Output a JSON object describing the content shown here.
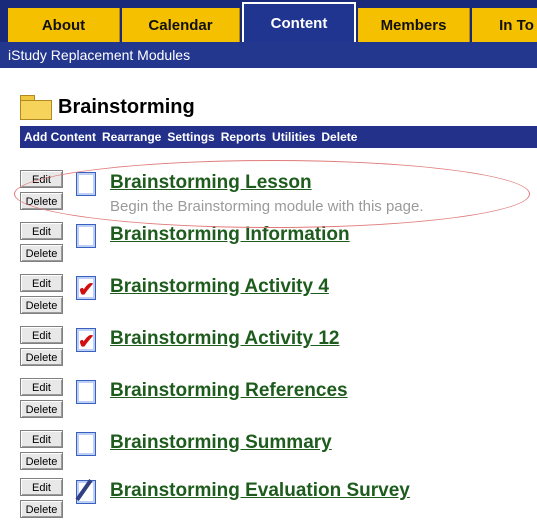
{
  "tabs": [
    {
      "label": "About"
    },
    {
      "label": "Calendar"
    },
    {
      "label": "Content"
    },
    {
      "label": "Members"
    },
    {
      "label": "In To"
    }
  ],
  "subheader": "iStudy Replacement Modules",
  "folder": {
    "title": "Brainstorming",
    "icon": "folder-icon"
  },
  "actions": [
    "Add Content",
    "Rearrange",
    "Settings",
    "Reports",
    "Utilities",
    "Delete"
  ],
  "buttons": {
    "edit": "Edit",
    "delete": "Delete"
  },
  "items": [
    {
      "title": "Brainstorming Lesson",
      "description": "Begin the Brainstorming module with this page.",
      "icon": "document-icon"
    },
    {
      "title": "Brainstorming Information",
      "icon": "document-icon"
    },
    {
      "title": "Brainstorming Activity 4",
      "icon": "assignment-check-icon"
    },
    {
      "title": "Brainstorming Activity 12",
      "icon": "assignment-check-icon"
    },
    {
      "title": "Brainstorming References",
      "icon": "document-icon"
    },
    {
      "title": "Brainstorming Summary",
      "icon": "document-icon"
    },
    {
      "title": "Brainstorming Evaluation Survey",
      "icon": "survey-pencil-icon"
    }
  ],
  "colors": {
    "tab": "#f5c000",
    "nav": "#1f3590",
    "link": "#1d5c1d",
    "highlight": "#e07a7a"
  }
}
